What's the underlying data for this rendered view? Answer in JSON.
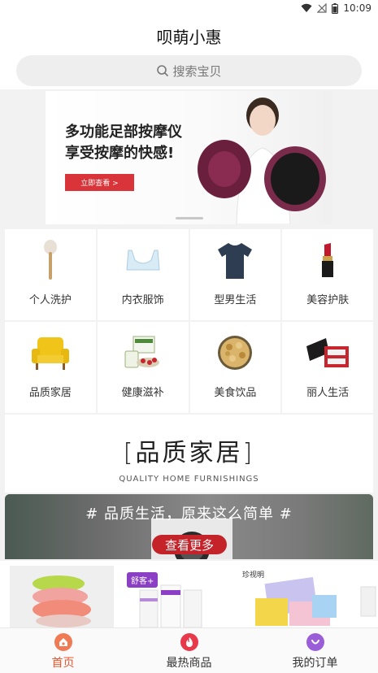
{
  "status_bar": {
    "time": "10:09"
  },
  "header": {
    "title": "呗萌小惠"
  },
  "search": {
    "placeholder": "搜索宝贝"
  },
  "banner": {
    "title_line1": "多功能足部按摩仪",
    "title_line2": "享受按摩的快感!",
    "button_label": "立即查看 >"
  },
  "categories": [
    {
      "label": "个人洗护",
      "icon": "bath-brush-icon"
    },
    {
      "label": "内衣服饰",
      "icon": "bra-icon"
    },
    {
      "label": "型男生活",
      "icon": "tshirt-icon"
    },
    {
      "label": "美容护肤",
      "icon": "lipstick-icon"
    },
    {
      "label": "品质家居",
      "icon": "armchair-icon"
    },
    {
      "label": "健康滋补",
      "icon": "supplement-icon"
    },
    {
      "label": "美食饮品",
      "icon": "cookie-tin-icon"
    },
    {
      "label": "丽人生活",
      "icon": "gift-box-icon"
    }
  ],
  "section": {
    "title": "[品质家居]",
    "subtitle": "QUALITY HOME FURNISHINGS"
  },
  "promo": {
    "tagline": "# 品质生活，原来这么简单 #",
    "button_label": "查看更多"
  },
  "products": [
    {
      "brand": ""
    },
    {
      "brand": "舒客+"
    },
    {
      "brand": "珍视明"
    }
  ],
  "tabs": [
    {
      "label": "首页",
      "icon": "home-icon",
      "active": true
    },
    {
      "label": "最热商品",
      "icon": "flame-icon",
      "active": false
    },
    {
      "label": "我的订单",
      "icon": "orders-icon",
      "active": false
    }
  ],
  "colors": {
    "accent": "#e8572f",
    "primary_red": "#d8343a",
    "tab_purple": "#9a5fd8"
  }
}
